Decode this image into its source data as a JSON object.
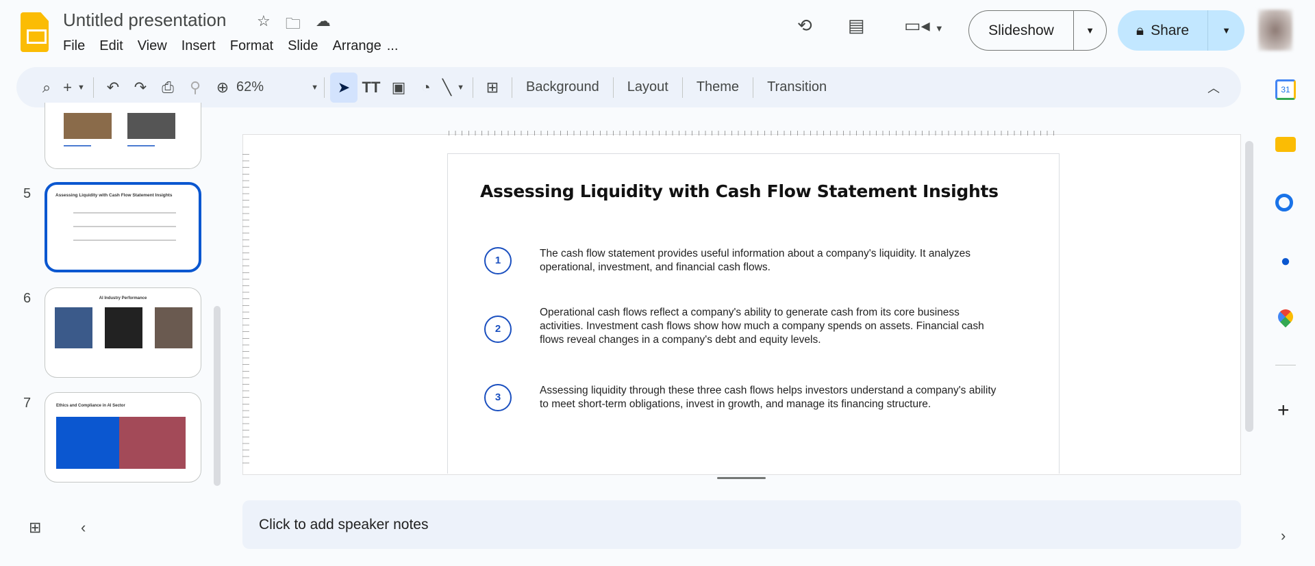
{
  "app": {
    "title": "Untitled presentation"
  },
  "menu": [
    "File",
    "Edit",
    "View",
    "Insert",
    "Format",
    "Slide",
    "Arrange",
    "..."
  ],
  "header": {
    "slideshow_label": "Slideshow",
    "share_label": "Share"
  },
  "toolbar": {
    "zoom": "62%",
    "background": "Background",
    "layout": "Layout",
    "theme": "Theme",
    "transition": "Transition"
  },
  "filmstrip": [
    {
      "number": "5",
      "title": "Assessing Liquidity with Cash Flow Statement Insights"
    },
    {
      "number": "6",
      "title": "AI Industry Performance"
    },
    {
      "number": "7",
      "title": "Ethics and Compliance in AI Sector"
    }
  ],
  "slide": {
    "title": "Assessing Liquidity with Cash Flow Statement Insights",
    "items": [
      {
        "num": "1",
        "text": "The cash flow statement provides useful information about a company's liquidity. It analyzes operational, investment, and financial cash flows."
      },
      {
        "num": "2",
        "text": "Operational cash flows reflect a company's ability to generate cash from its core business activities. Investment cash flows show how much a company spends on assets. Financial cash flows reveal changes in a company's debt and equity levels."
      },
      {
        "num": "3",
        "text": "Assessing liquidity through these three cash flows helps investors understand a company's ability to meet short-term obligations, invest in growth, and manage its financing structure."
      }
    ]
  },
  "notes": {
    "placeholder": "Click to add speaker notes"
  },
  "side_panel": {
    "calendar_day": "31"
  },
  "colors": {
    "accent": "#0b57d0",
    "share_bg": "#c2e7ff",
    "slide_circle": "#1a4fbf"
  }
}
